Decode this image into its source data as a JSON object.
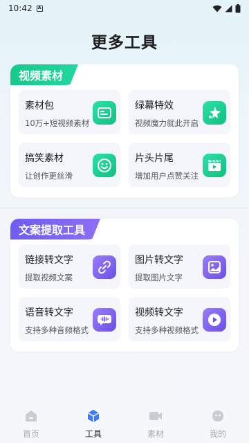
{
  "status_bar": {
    "time": "10:42"
  },
  "page_title": "更多工具",
  "sections": [
    {
      "title": "视频素材",
      "tools": [
        {
          "title": "素材包",
          "desc": "10万+短视频素材",
          "icon": "folder-icon"
        },
        {
          "title": "绿幕特效",
          "desc": "视频魔力就此开启",
          "icon": "sparkle-icon"
        },
        {
          "title": "搞笑素材",
          "desc": "让创作更丝滑",
          "icon": "smile-icon"
        },
        {
          "title": "片头片尾",
          "desc": "增加用户点赞关注",
          "icon": "clapper-icon"
        }
      ]
    },
    {
      "title": "文案提取工具",
      "tools": [
        {
          "title": "链接转文字",
          "desc": "提取视频文案",
          "icon": "link-icon"
        },
        {
          "title": "图片转文字",
          "desc": "提取图片文字",
          "icon": "image-icon"
        },
        {
          "title": "语音转文字",
          "desc": "支持多种音频格式",
          "icon": "audio-icon"
        },
        {
          "title": "视频转文字",
          "desc": "支持多种视频格式",
          "icon": "play-icon"
        }
      ]
    }
  ],
  "tabs": [
    {
      "label": "首页",
      "icon": "home-icon",
      "active": false
    },
    {
      "label": "工具",
      "icon": "cube-icon",
      "active": true
    },
    {
      "label": "素材",
      "icon": "camera-icon",
      "active": false
    },
    {
      "label": "我的",
      "icon": "profile-icon",
      "active": false
    }
  ],
  "colors": {
    "green_start": "#1fd39a",
    "green_end": "#11c37f",
    "purple_start": "#7b6cf0",
    "purple_end": "#5b46e6",
    "active_tab": "#3d7cf2",
    "inactive_tab": "#c9ccd3"
  }
}
